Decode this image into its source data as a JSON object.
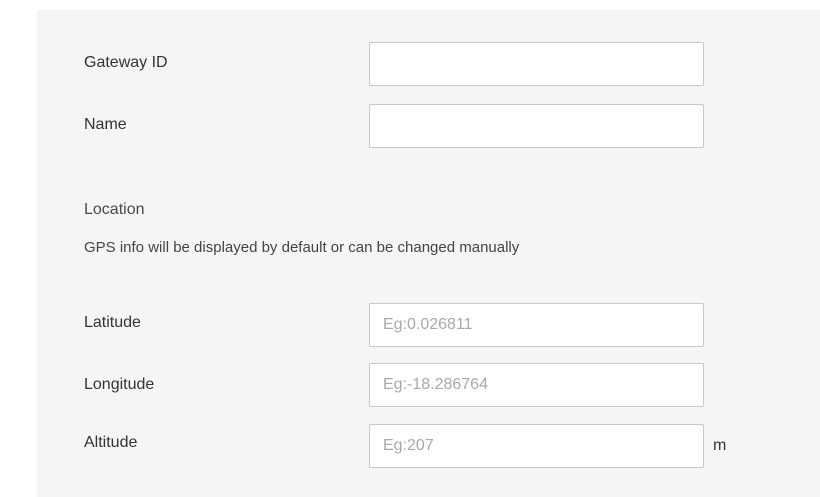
{
  "form": {
    "gateway_id": {
      "label": "Gateway ID",
      "value": "",
      "placeholder": ""
    },
    "name": {
      "label": "Name",
      "value": "",
      "placeholder": ""
    },
    "location": {
      "title": "Location",
      "hint": "GPS info will be displayed by default or can be changed manually",
      "latitude": {
        "label": "Latitude",
        "value": "",
        "placeholder": "Eg:0.026811"
      },
      "longitude": {
        "label": "Longitude",
        "value": "",
        "placeholder": "Eg:-18.286764"
      },
      "altitude": {
        "label": "Altitude",
        "value": "",
        "placeholder": "Eg:207",
        "unit": "m"
      }
    }
  }
}
